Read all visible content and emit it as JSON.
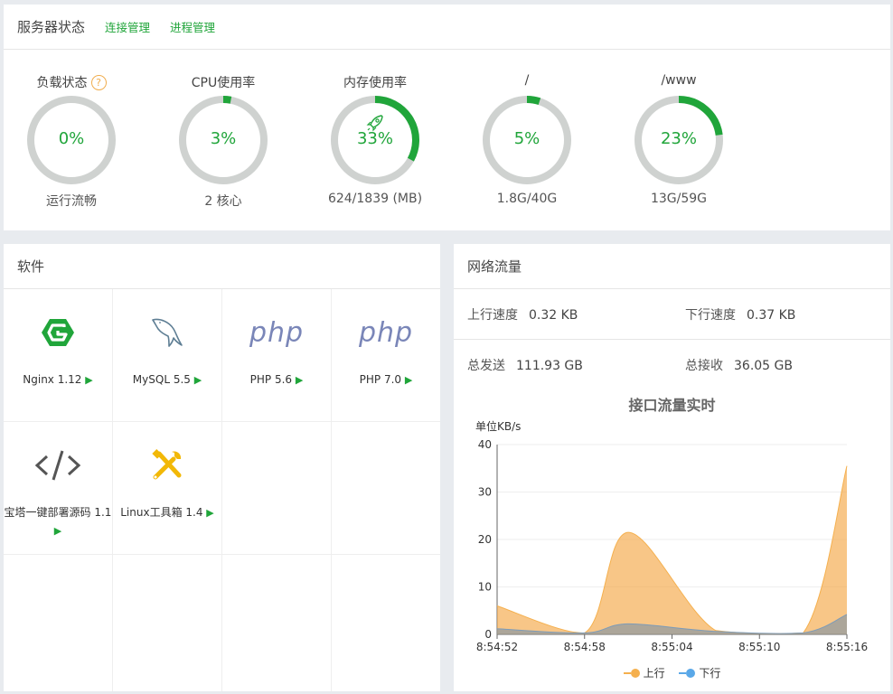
{
  "status": {
    "title": "服务器状态",
    "links": [
      "连接管理",
      "进程管理"
    ],
    "gauges": [
      {
        "label": "负载状态",
        "value": "0%",
        "percent": 0,
        "sub": "运行流畅",
        "help": "?"
      },
      {
        "label": "CPU使用率",
        "value": "3%",
        "percent": 3,
        "sub": "2 核心"
      },
      {
        "label": "内存使用率",
        "value": "33%",
        "percent": 33,
        "sub": "624/1839 (MB)",
        "icon": "rocket-icon"
      },
      {
        "label": "/",
        "value": "5%",
        "percent": 5,
        "sub": "1.8G/40G"
      },
      {
        "label": "/www",
        "value": "23%",
        "percent": 23,
        "sub": "13G/59G"
      }
    ],
    "colors": {
      "accent": "#20a53a",
      "track": "#cfd2d0"
    }
  },
  "software": {
    "title": "软件",
    "items": [
      {
        "name": "Nginx 1.12",
        "icon": "nginx-icon"
      },
      {
        "name": "MySQL 5.5",
        "icon": "mysql-dolphin-icon"
      },
      {
        "name": "PHP 5.6",
        "icon": "php-icon",
        "icon_text": "php"
      },
      {
        "name": "PHP 7.0",
        "icon": "php-icon",
        "icon_text": "php"
      },
      {
        "name": "宝塔一键部署源码 1.1",
        "icon": "code-icon"
      },
      {
        "name": "Linux工具箱 1.4",
        "icon": "tools-icon"
      }
    ],
    "play_glyph": "▶"
  },
  "network": {
    "title": "网络流量",
    "up_speed_label": "上行速度",
    "up_speed": "0.32 KB",
    "down_speed_label": "下行速度",
    "down_speed": "0.37 KB",
    "total_sent_label": "总发送",
    "total_sent": "111.93 GB",
    "total_recv_label": "总接收",
    "total_recv": "36.05 GB"
  },
  "chart_data": {
    "type": "area",
    "title": "接口流量实时",
    "ylabel": "单位KB/s",
    "ylim": [
      0,
      40
    ],
    "yticks": [
      0,
      10,
      20,
      30,
      40
    ],
    "x": [
      "8:54:52",
      "8:54:58",
      "8:55:04",
      "8:55:10",
      "8:55:16"
    ],
    "series": [
      {
        "name": "上行",
        "color": "#f5b04e",
        "values": [
          6,
          0.3,
          21.5,
          0.8,
          0.3,
          35.5
        ]
      },
      {
        "name": "下行",
        "color": "#5aa8e8",
        "values": [
          1.2,
          0.3,
          2.2,
          0.6,
          0.3,
          4.2
        ]
      }
    ],
    "sample_x": [
      0,
      6,
      9,
      15,
      21,
      24
    ],
    "grid": true,
    "legend": "bottom"
  }
}
